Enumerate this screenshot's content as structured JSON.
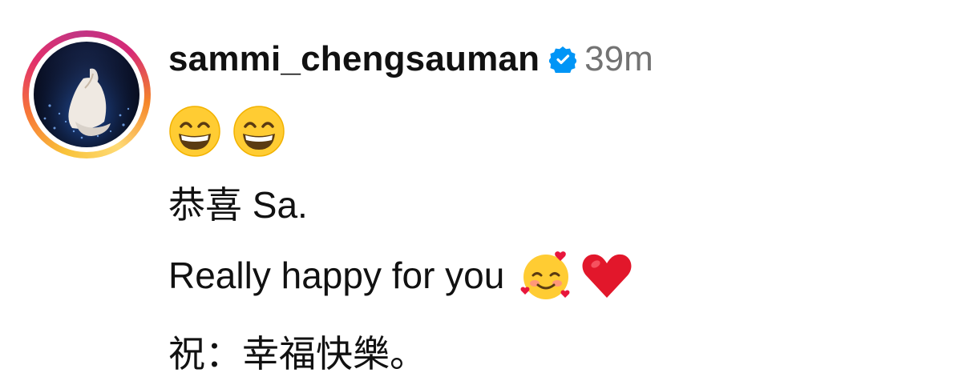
{
  "comment": {
    "username": "sammi_chengsauman",
    "verified": true,
    "timestamp": "39m",
    "lead_emojis": [
      "grinning-face-with-smiling-eyes",
      "grinning-face-with-smiling-eyes"
    ],
    "lines": [
      "恭喜 Sa.",
      "Really happy for you",
      "祝：幸福快樂。"
    ],
    "trailing_emojis_line2": [
      "smiling-face-with-hearts",
      "red-heart"
    ]
  },
  "colors": {
    "verified_badge": "#0095f6",
    "timestamp": "#737373",
    "text": "#111111"
  }
}
